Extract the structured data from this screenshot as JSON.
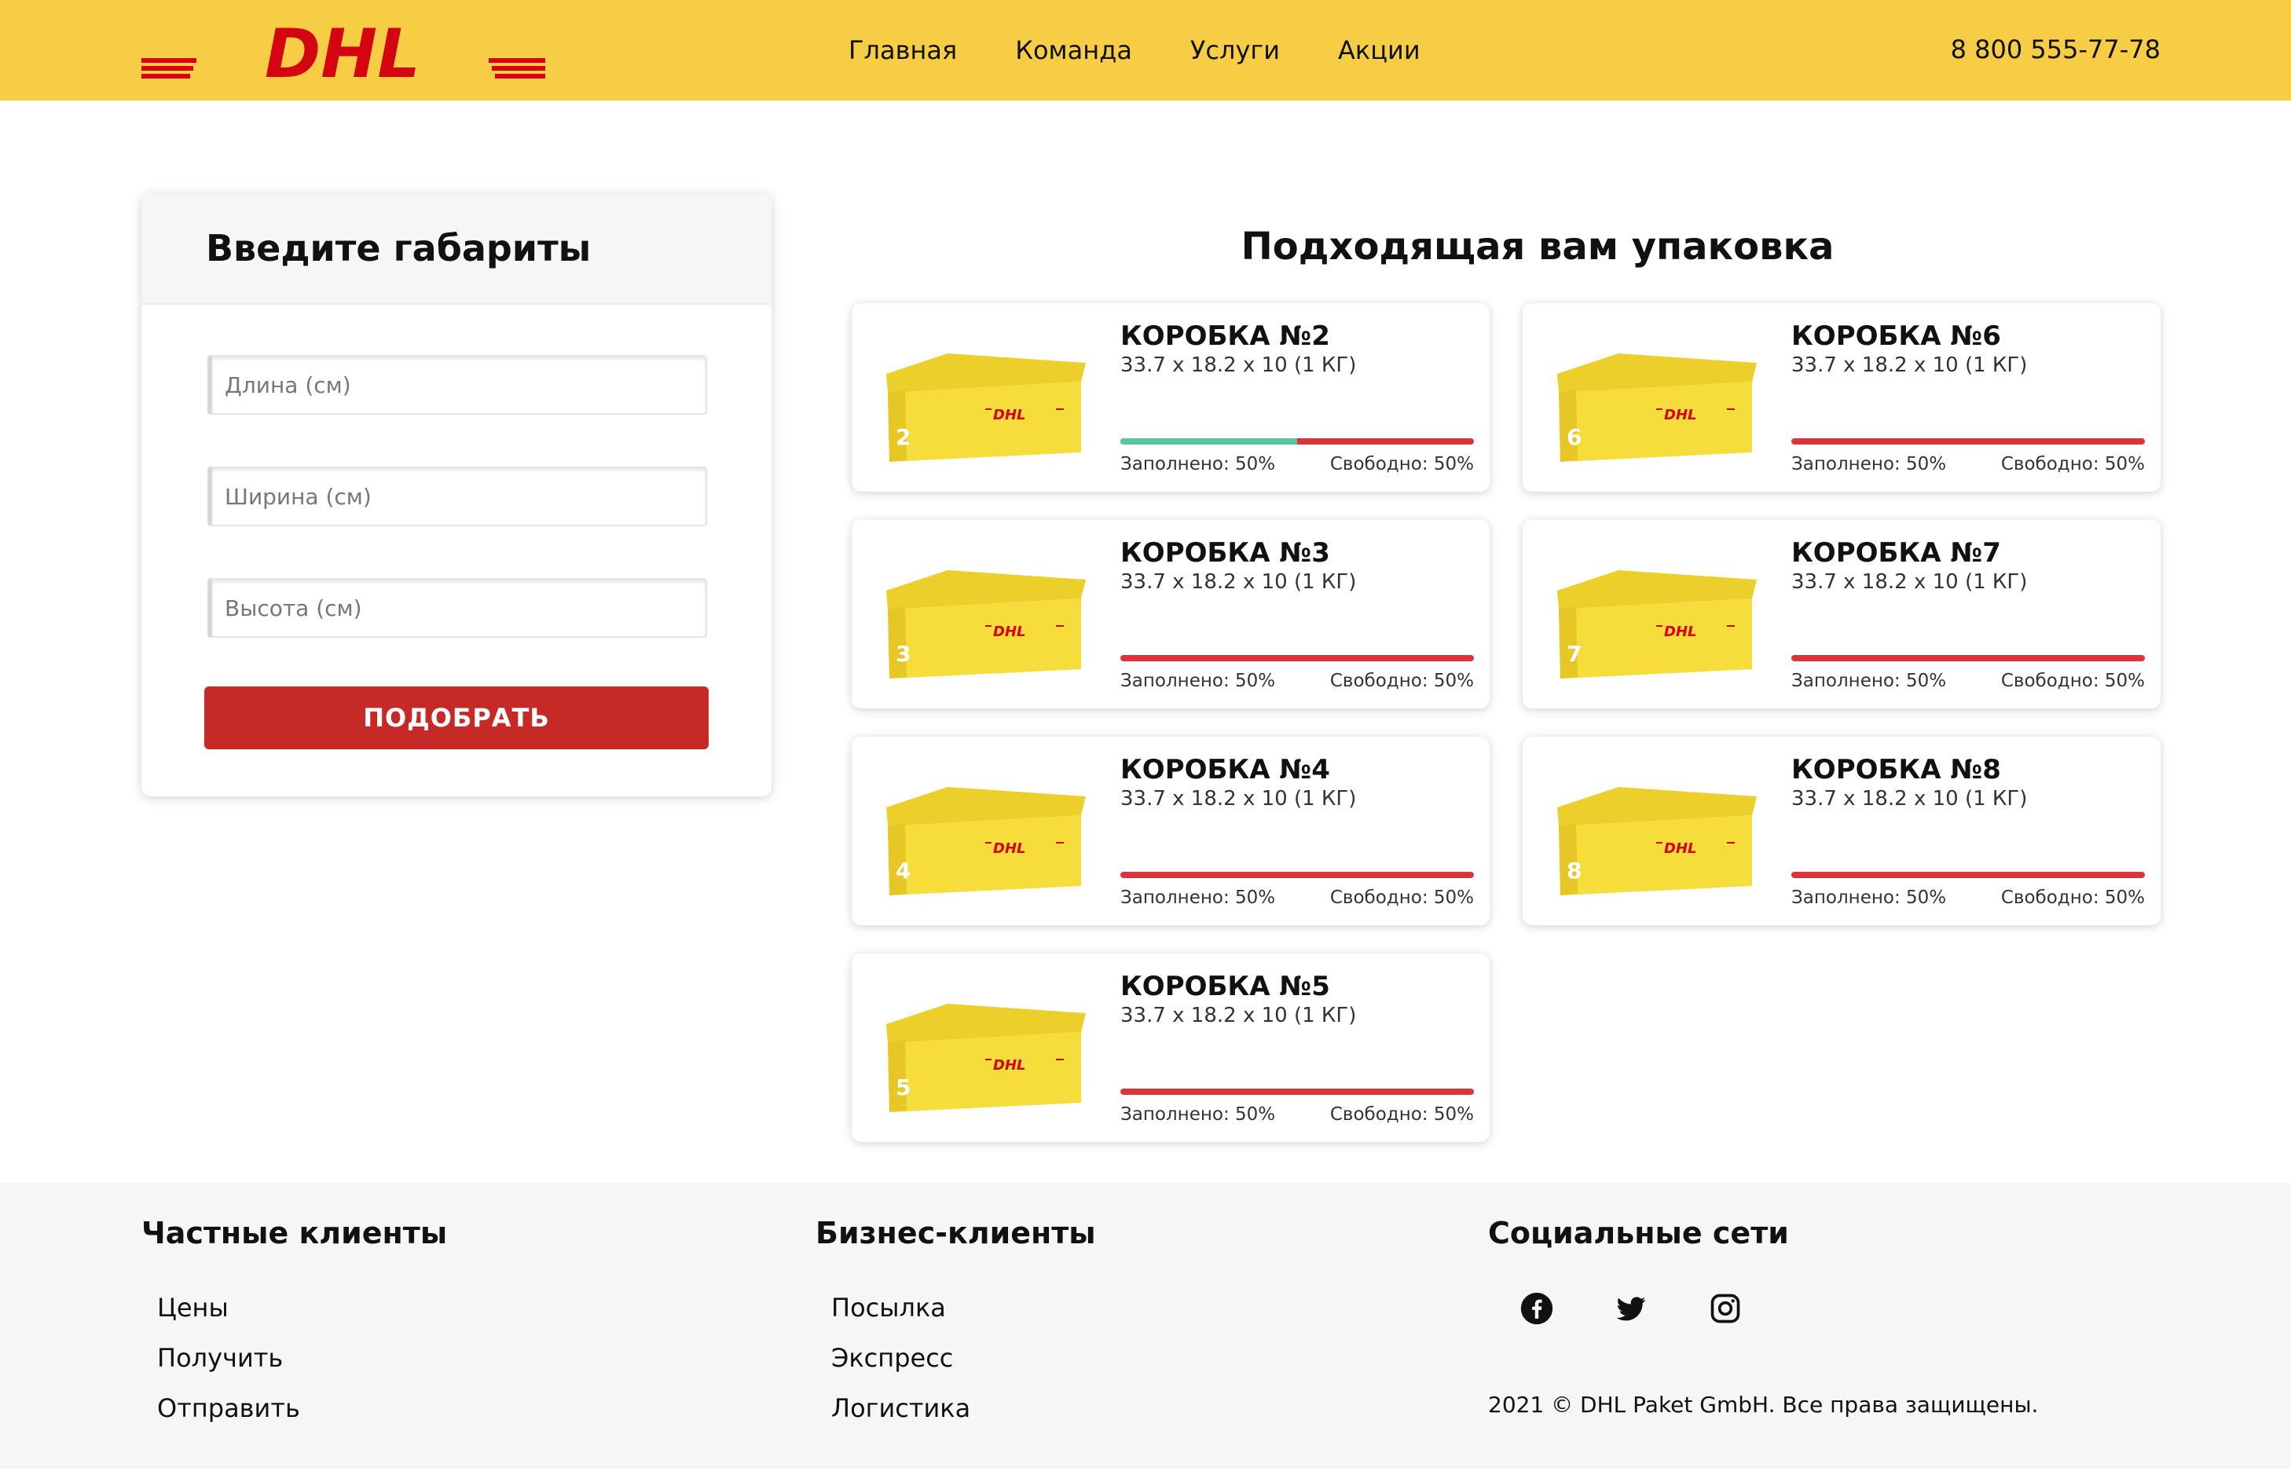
{
  "header": {
    "logo_text": "DHL",
    "nav": [
      "Главная",
      "Команда",
      "Услуги",
      "Акции"
    ],
    "phone": "8 800 555-77-78",
    "colors": {
      "background": "#f8cd46",
      "logo_red": "#d40511"
    }
  },
  "form": {
    "title": "Введите габариты",
    "length_placeholder": "Длина (см)",
    "width_placeholder": "Ширина (см)",
    "height_placeholder": "Высота (см)",
    "submit_label": "ПОДОБРАТЬ",
    "button_color": "#c62a26"
  },
  "results": {
    "title": "Подходящая вам упаковка",
    "boxes": [
      {
        "name": "КОРОБКА №2",
        "dims": "33.7 x 18.2 x 10 (1 КГ)",
        "filled_label": "Заполнено: 50%",
        "free_label": "Свободно: 50%",
        "fill_fraction": 0.5,
        "image_number": "2"
      },
      {
        "name": "КОРОБКА №6",
        "dims": "33.7 x 18.2 x 10 (1 КГ)",
        "filled_label": "Заполнено: 50%",
        "free_label": "Свободно: 50%",
        "fill_fraction": 0,
        "image_number": "6"
      },
      {
        "name": "КОРОБКА №3",
        "dims": "33.7 x 18.2 x 10 (1 КГ)",
        "filled_label": "Заполнено: 50%",
        "free_label": "Свободно: 50%",
        "fill_fraction": 0,
        "image_number": "3"
      },
      {
        "name": "КОРОБКА №7",
        "dims": "33.7 x 18.2 x 10 (1 КГ)",
        "filled_label": "Заполнено: 50%",
        "free_label": "Свободно: 50%",
        "fill_fraction": 0,
        "image_number": "7"
      },
      {
        "name": "КОРОБКА №4",
        "dims": "33.7 x 18.2 x 10 (1 КГ)",
        "filled_label": "Заполнено: 50%",
        "free_label": "Свободно: 50%",
        "fill_fraction": 0,
        "image_number": "4"
      },
      {
        "name": "КОРОБКА №8",
        "dims": "33.7 x 18.2 x 10 (1 КГ)",
        "filled_label": "Заполнено: 50%",
        "free_label": "Свободно: 50%",
        "fill_fraction": 0,
        "image_number": "8"
      },
      {
        "name": "КОРОБКА №5",
        "dims": "33.7 x 18.2 x 10 (1 КГ)",
        "filled_label": "Заполнено: 50%",
        "free_label": "Свободно: 50%",
        "fill_fraction": 0,
        "image_number": "5"
      }
    ],
    "colors": {
      "bar_free": "#d9353b",
      "bar_filled": "#58c99a",
      "box_yellow": "#f7dd3b"
    }
  },
  "footer": {
    "private": {
      "title": "Частные клиенты",
      "links": [
        "Цены",
        "Получить",
        "Отправить"
      ]
    },
    "business": {
      "title": "Бизнес-клиенты",
      "links": [
        "Посылка",
        "Экспресс",
        "Логистика"
      ]
    },
    "social": {
      "title": "Социальные сети",
      "icons": [
        "facebook-icon",
        "twitter-icon",
        "instagram-icon"
      ]
    },
    "copyright": "2021 © DHL Paket GmbH. Все права защищены."
  }
}
